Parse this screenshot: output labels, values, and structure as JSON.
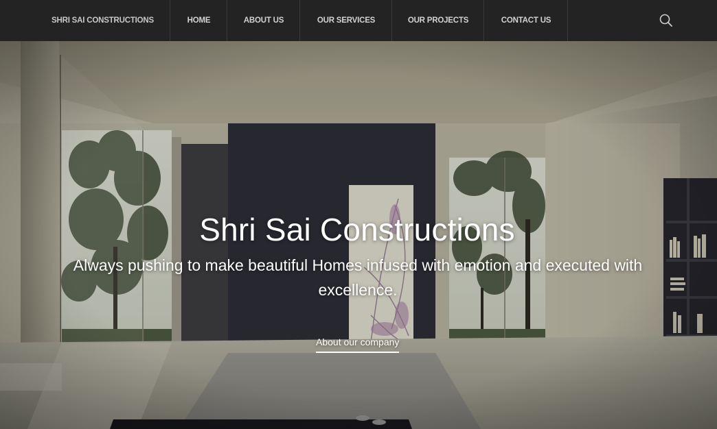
{
  "nav": {
    "brand": "SHRI SAI CONSTRUCTIONS",
    "items": [
      {
        "label": "HOME"
      },
      {
        "label": "ABOUT US"
      },
      {
        "label": "OUR SERVICES"
      },
      {
        "label": "OUR PROJECTS"
      },
      {
        "label": "CONTACT US"
      }
    ],
    "search_icon": "search-icon"
  },
  "hero": {
    "title": "Shri Sai Constructions",
    "subtitle": "Always pushing to make beautiful Homes infused with emotion and executed with excellence.",
    "link_label": "About our company"
  },
  "colors": {
    "navbar_bg": "#232323",
    "nav_text": "#d2d2d2",
    "hero_text": "#ffffff"
  }
}
